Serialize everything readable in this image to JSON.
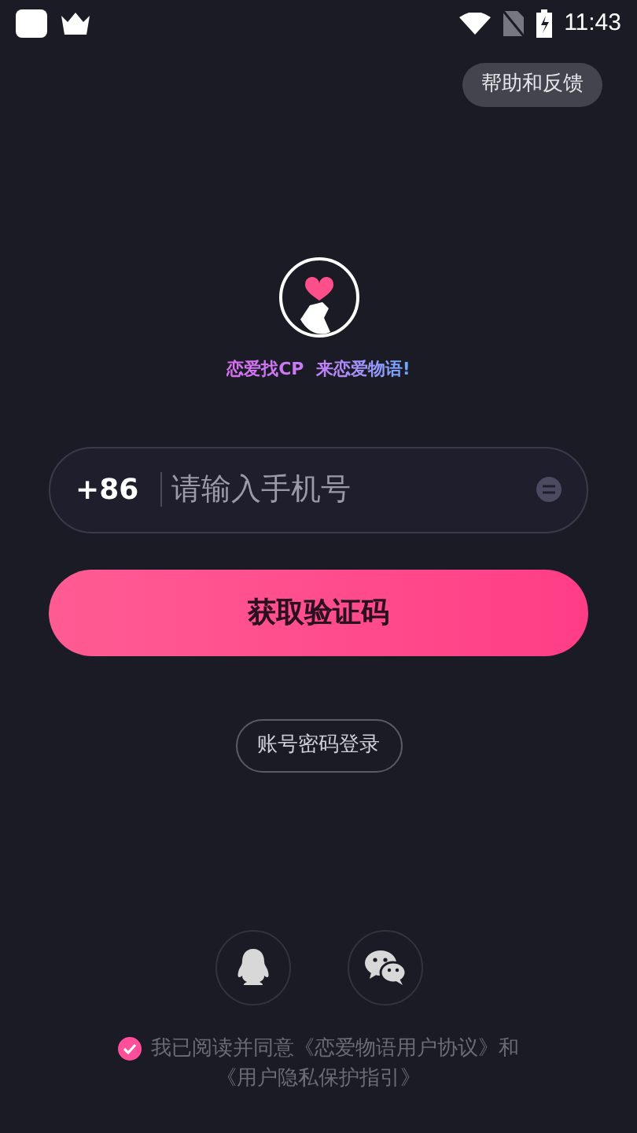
{
  "status_bar": {
    "time": "11:43"
  },
  "help_button": {
    "label": "帮助和反馈"
  },
  "slogan": "恋爱找CP  来恋爱物语!",
  "phone_field": {
    "country_code": "+86",
    "placeholder": "请输入手机号"
  },
  "get_code_button": {
    "label": "获取验证码"
  },
  "password_login": {
    "label": "账号密码登录"
  },
  "social_logins": [
    {
      "kind": "qq"
    },
    {
      "kind": "wechat"
    }
  ],
  "agreement": {
    "checked": true,
    "prefix": "我已阅读并同意",
    "links": [
      "《恋爱物语用户协议》",
      "《用户隐私保护指引》"
    ],
    "joiner": "和"
  }
}
